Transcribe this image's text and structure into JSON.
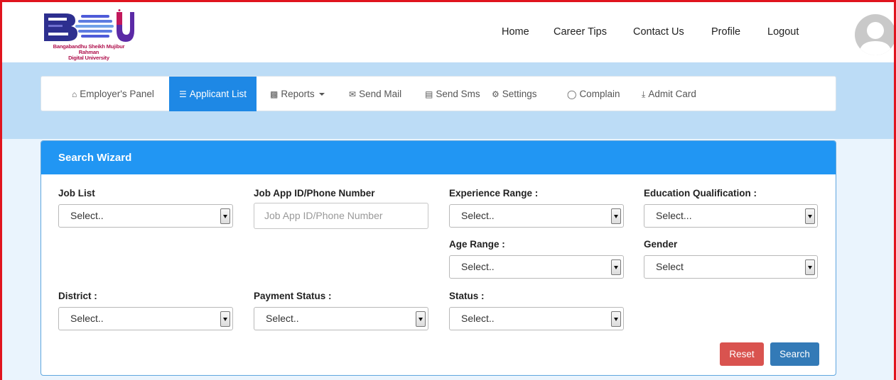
{
  "logo": {
    "line1": "Bangabandhu Sheikh Mujibur Rahman",
    "line2": "Digital University"
  },
  "topnav": [
    "Home",
    "Career Tips",
    "Contact Us",
    "Profile",
    "Logout"
  ],
  "panelnav": {
    "employers_panel": "Employer's Panel",
    "applicant_list": "Applicant List",
    "reports": "Reports",
    "send_mail": "Send Mail",
    "send_sms": "Send Sms",
    "settings": "Settings",
    "complain": "Complain",
    "admit_card": "Admit Card"
  },
  "search": {
    "title": "Search Wizard",
    "job_list": {
      "label": "Job List",
      "value": "Select.."
    },
    "job_app_id": {
      "label": "Job App ID/Phone Number",
      "placeholder": "Job App ID/Phone Number"
    },
    "experience": {
      "label": "Experience Range :",
      "value": "Select.."
    },
    "education": {
      "label": "Education Qualification :",
      "value": "Select..."
    },
    "age": {
      "label": "Age Range :",
      "value": "Select.."
    },
    "gender": {
      "label": "Gender",
      "value": "Select"
    },
    "district": {
      "label": "District :",
      "value": "Select.."
    },
    "payment": {
      "label": "Payment Status :",
      "value": "Select.."
    },
    "status": {
      "label": "Status :",
      "value": "Select.."
    },
    "reset_label": "Reset",
    "search_label": "Search"
  },
  "colors": {
    "accent": "#2196f3",
    "band": "#bcdcf6",
    "reset": "#d9534f",
    "search": "#337ab7",
    "frame": "#e0141e"
  }
}
